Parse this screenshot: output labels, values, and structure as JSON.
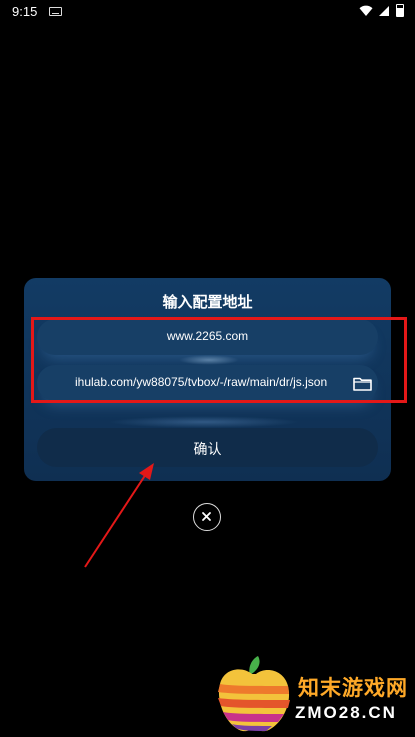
{
  "status_bar": {
    "time": "9:15",
    "icons": [
      "keyboard-icon",
      "wifi-icon",
      "signal-icon",
      "battery-icon"
    ]
  },
  "dialog": {
    "title": "输入配置地址",
    "field_1_value": "www.2265.com",
    "field_2_value": "ihulab.com/yw88075/tvbox/-/raw/main/dr/js.json",
    "confirm_label": "确认"
  },
  "annotation": {
    "highlight_color": "#e41818",
    "arrow_color": "#e41818"
  },
  "watermark": {
    "title": "知末游戏网",
    "url": "ZMO28.CN"
  },
  "colors": {
    "dialog_bg": "#123b64",
    "field_bg": "#173f66",
    "button_bg": "#102c4a"
  }
}
